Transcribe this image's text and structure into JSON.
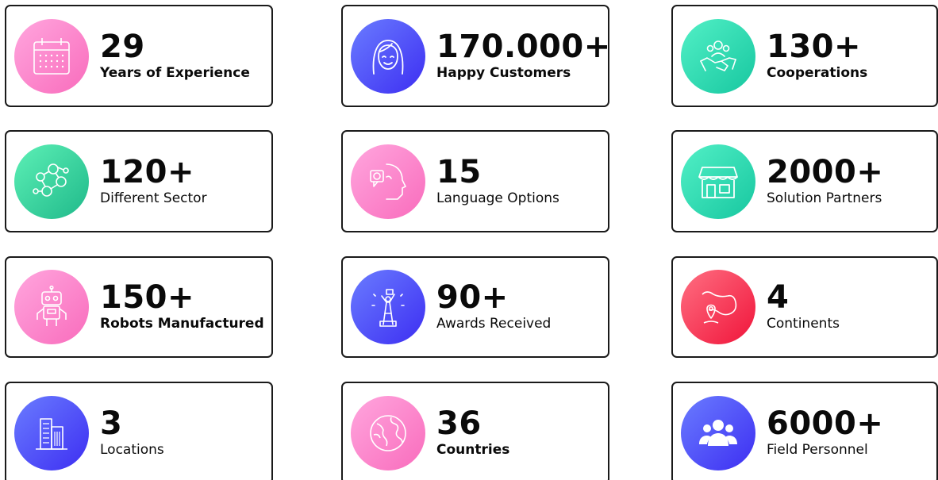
{
  "stats": [
    {
      "value": "29",
      "label": "Years of Experience",
      "icon": "calendar-icon",
      "gradient": [
        "#ffa6de",
        "#f96cbc"
      ]
    },
    {
      "value": "170.000+",
      "label": "Happy Customers",
      "icon": "woman-face-icon",
      "gradient": [
        "#6a7cff",
        "#3d2ef2"
      ]
    },
    {
      "value": "130+",
      "label": "Cooperations",
      "icon": "handshake-icon",
      "gradient": [
        "#52f0c6",
        "#17c7a0"
      ]
    },
    {
      "value": "120+",
      "label": "Different Sector",
      "icon": "network-people-icon",
      "gradient": [
        "#5df0b6",
        "#1fb98a"
      ]
    },
    {
      "value": "15",
      "label": "Language Options",
      "icon": "speaking-head-icon",
      "gradient": [
        "#ffa6de",
        "#f96cbc"
      ]
    },
    {
      "value": "2000+",
      "label": "Solution Partners",
      "icon": "storefront-icon",
      "gradient": [
        "#52f0c6",
        "#17c7a0"
      ]
    },
    {
      "value": "150+",
      "label": "Robots Manufactured",
      "icon": "robot-icon",
      "gradient": [
        "#ffa6de",
        "#f96cbc"
      ]
    },
    {
      "value": "90+",
      "label": "Awards Received",
      "icon": "trophy-winner-icon",
      "gradient": [
        "#6a7cff",
        "#3d2ef2"
      ]
    },
    {
      "value": "4",
      "label": "Continents",
      "icon": "map-pin-icon",
      "gradient": [
        "#ff6f82",
        "#f0143a"
      ]
    },
    {
      "value": "3",
      "label": "Locations",
      "icon": "buildings-icon",
      "gradient": [
        "#6a7cff",
        "#3d2ef2"
      ]
    },
    {
      "value": "36",
      "label": "Countries",
      "icon": "globe-icon",
      "gradient": [
        "#ffa6de",
        "#f96cbc"
      ]
    },
    {
      "value": "6000+",
      "label": "Field Personnel",
      "icon": "team-icon",
      "gradient": [
        "#6a7cff",
        "#3d2ef2"
      ]
    }
  ]
}
